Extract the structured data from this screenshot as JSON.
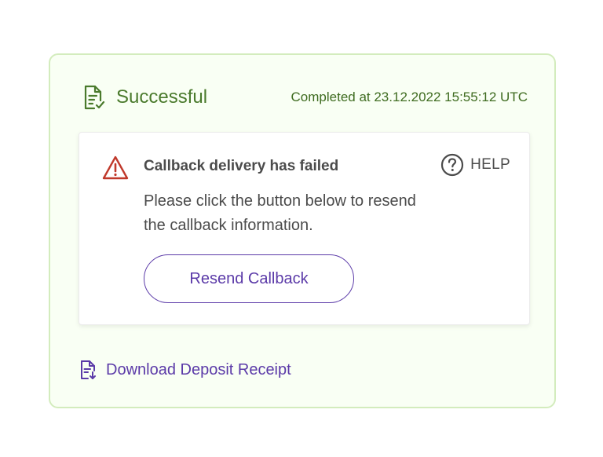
{
  "status": {
    "icon": "document-check-icon",
    "label": "Successful",
    "completed_text": "Completed at 23.12.2022  15:55:12 UTC"
  },
  "alert": {
    "icon": "warning-icon",
    "title": "Callback delivery has failed",
    "message": "Please click the button below to resend the callback information.",
    "help_icon": "question-circle-icon",
    "help_label": "HELP",
    "button_label": "Resend Callback"
  },
  "download": {
    "icon": "document-download-icon",
    "label": "Download Deposit Receipt"
  },
  "colors": {
    "success_green": "#4a7a2c",
    "card_border": "#d3ecbd",
    "error_red": "#c0392b",
    "accent_purple": "#5b3aa8",
    "text_gray": "#4b4b4b"
  }
}
